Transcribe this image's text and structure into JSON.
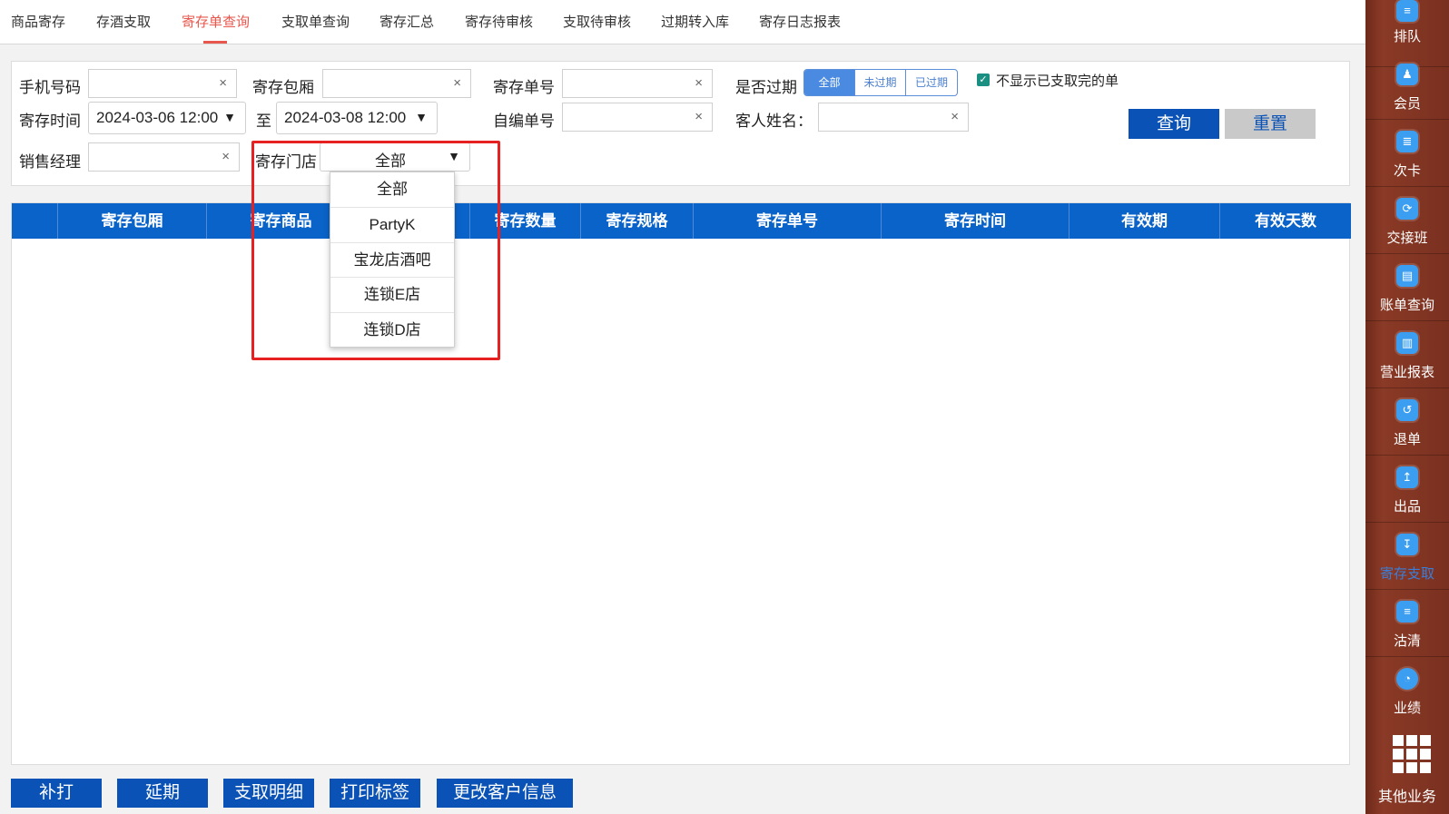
{
  "tabs": [
    "商品寄存",
    "存酒支取",
    "寄存单查询",
    "支取单查询",
    "寄存汇总",
    "寄存待审核",
    "支取待审核",
    "过期转入库",
    "寄存日志报表"
  ],
  "active_tab": "寄存单查询",
  "filters": {
    "phone_label": "手机号码",
    "room_label": "寄存包厢",
    "order_no_label": "寄存单号",
    "expired_label": "是否过期",
    "expired_options": [
      "全部",
      "未过期",
      "已过期"
    ],
    "expired_selected": "全部",
    "hide_done_label": "不显示已支取完的单",
    "hide_done_checked": true,
    "time_label": "寄存时间",
    "time_from": "2024-03-06 12:00",
    "to_label": "至",
    "time_to": "2024-03-08 12:00",
    "custom_no_label": "自编单号",
    "guest_name_label": "客人姓名：",
    "manager_label": "销售经理",
    "store_label": "寄存门店",
    "store_value": "全部",
    "clear_symbol": "×",
    "caret_symbol": "▼"
  },
  "buttons": {
    "query": "查询",
    "reset": "重置"
  },
  "store_dropdown": [
    "全部",
    "PartyK",
    "宝龙店酒吧",
    "连锁E店",
    "连锁D店"
  ],
  "table": {
    "columns": [
      "",
      "寄存包厢",
      "寄存商品",
      "",
      "寄存数量",
      "寄存规格",
      "寄存单号",
      "寄存时间",
      "有效期",
      "有效天数"
    ],
    "rows": []
  },
  "bottom_buttons": [
    "补打",
    "延期",
    "支取明细",
    "打印标签",
    "更改客户信息"
  ],
  "sidebar": [
    {
      "label": "排队",
      "icon": "queue-icon"
    },
    {
      "label": "会员",
      "icon": "member-icon"
    },
    {
      "label": "次卡",
      "icon": "card-icon"
    },
    {
      "label": "交接班",
      "icon": "shift-icon"
    },
    {
      "label": "账单查询",
      "icon": "bill-icon"
    },
    {
      "label": "营业报表",
      "icon": "report-icon"
    },
    {
      "label": "退单",
      "icon": "refund-icon"
    },
    {
      "label": "出品",
      "icon": "dispatch-icon"
    },
    {
      "label": "寄存支取",
      "icon": "storage-icon"
    },
    {
      "label": "沽清",
      "icon": "soldout-icon"
    },
    {
      "label": "业绩",
      "icon": "performance-icon"
    },
    {
      "label": "其他业务",
      "icon": "grid-icon"
    }
  ],
  "sidebar_active": "寄存支取",
  "colors": {
    "accent": "#0a52b5",
    "active_tab": "#e8574d",
    "highlight": "#e52121",
    "sidebar": "#7a3020"
  }
}
